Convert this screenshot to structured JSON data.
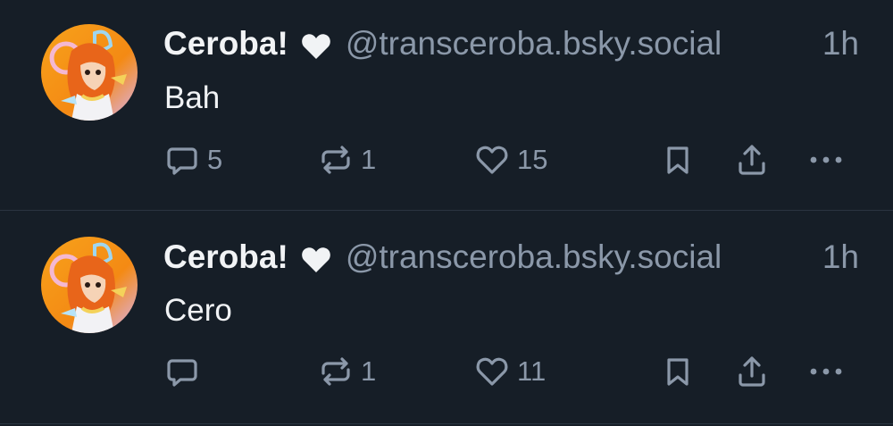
{
  "posts": [
    {
      "author": {
        "display_name": "Ceroba!",
        "badge_icon": "heart-icon",
        "handle": "@transceroba.bsky.social"
      },
      "time": "1h",
      "text": "Bah",
      "reply_count": "5",
      "repost_count": "1",
      "like_count": "15"
    },
    {
      "author": {
        "display_name": "Ceroba!",
        "badge_icon": "heart-icon",
        "handle": "@transceroba.bsky.social"
      },
      "time": "1h",
      "text": "Cero",
      "reply_count": "",
      "repost_count": "1",
      "like_count": "11"
    }
  ],
  "colors": {
    "background": "#161e27",
    "text_primary": "#f1f3f5",
    "text_secondary": "#8b98a9",
    "divider": "#2a3440",
    "avatar_orange": "#f39a1d"
  }
}
